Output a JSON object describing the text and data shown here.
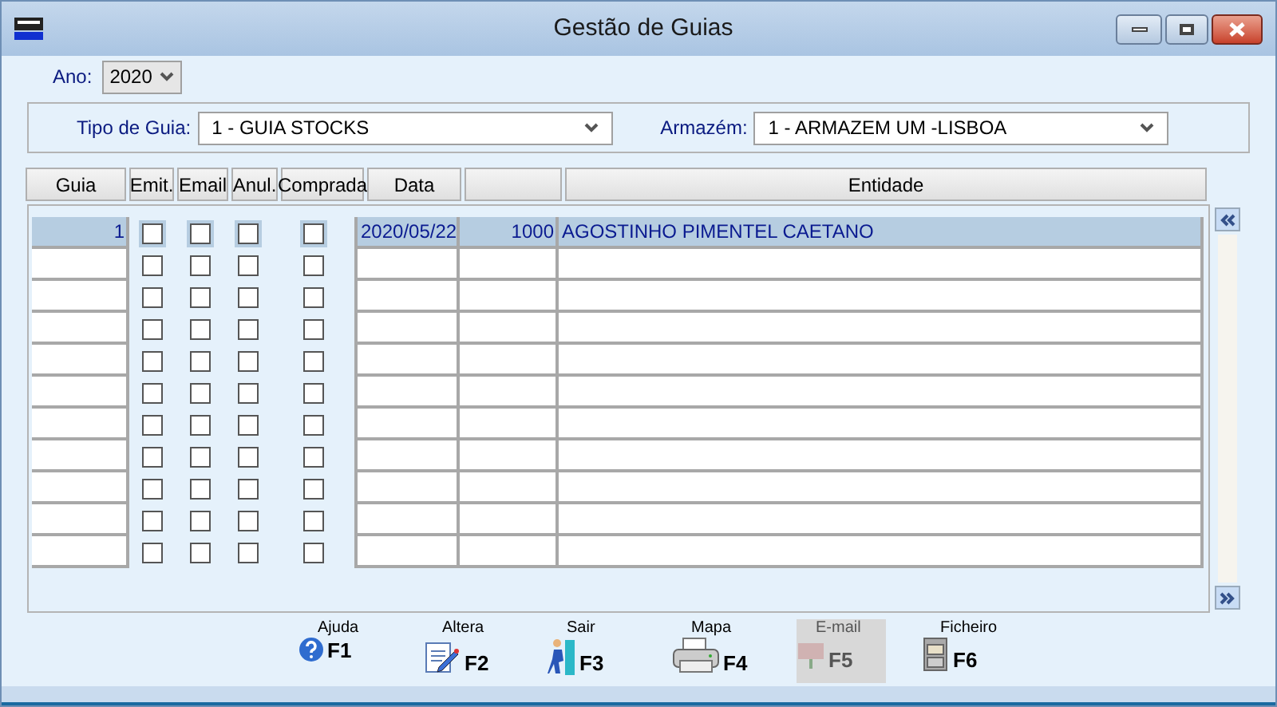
{
  "window": {
    "title": "Gestão de Guias"
  },
  "ano": {
    "label": "Ano:",
    "value": "2020"
  },
  "tipo_de_guia": {
    "label": "Tipo de Guia:",
    "value": "1 - GUIA STOCKS"
  },
  "armazem": {
    "label": "Armazém:",
    "value": "1 - ARMAZEM UM -LISBOA"
  },
  "table": {
    "columns": [
      "Guia",
      "Emit.",
      "Email",
      "Anul.",
      "Comprada",
      "Data",
      "Entidade"
    ],
    "rows": [
      {
        "selected": true,
        "guia": "1",
        "emit": false,
        "email": false,
        "anul": false,
        "comprada": false,
        "data": "2020/05/22",
        "column_7": "1000",
        "entidade": "AGOSTINHO PIMENTEL CAETANO"
      },
      {
        "selected": false,
        "emit": false,
        "email": false,
        "anul": false,
        "comprada": false
      },
      {
        "selected": false,
        "emit": false,
        "email": false,
        "anul": false,
        "comprada": false
      },
      {
        "selected": false,
        "emit": false,
        "email": false,
        "anul": false,
        "comprada": false
      },
      {
        "selected": false,
        "emit": false,
        "email": false,
        "anul": false,
        "comprada": false
      },
      {
        "selected": false,
        "emit": false,
        "email": false,
        "anul": false,
        "comprada": false
      },
      {
        "selected": false,
        "emit": false,
        "email": false,
        "anul": false,
        "comprada": false
      },
      {
        "selected": false,
        "emit": false,
        "email": false,
        "anul": false,
        "comprada": false
      },
      {
        "selected": false,
        "emit": false,
        "email": false,
        "anul": false,
        "comprada": false
      },
      {
        "selected": false,
        "emit": false,
        "email": false,
        "anul": false,
        "comprada": false
      },
      {
        "selected": false,
        "emit": false,
        "email": false,
        "anul": false,
        "comprada": false
      }
    ]
  },
  "toolbar": [
    {
      "kind": "help",
      "label": "Ajuda",
      "key": "F1",
      "disabled": false
    },
    {
      "kind": "edit",
      "label": "Altera",
      "key": "F2",
      "disabled": false
    },
    {
      "kind": "exit",
      "label": "Sair",
      "key": "F3",
      "disabled": false
    },
    {
      "kind": "print",
      "label": "Mapa",
      "key": "F4",
      "disabled": false
    },
    {
      "kind": "mail",
      "label": "E-mail",
      "key": "F5",
      "disabled": true
    },
    {
      "kind": "file",
      "label": "Ficheiro",
      "key": "F6",
      "disabled": false
    }
  ]
}
